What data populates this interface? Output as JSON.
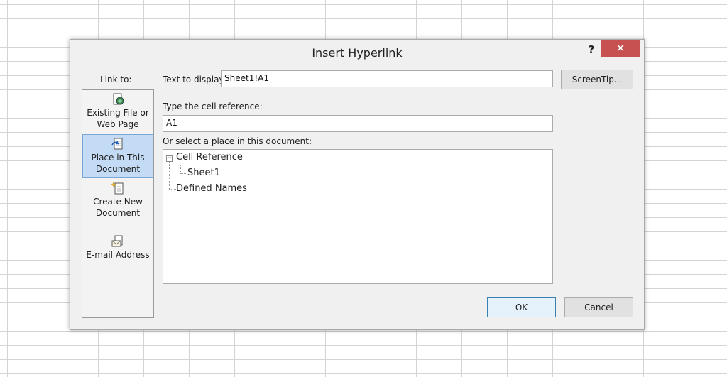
{
  "dialog": {
    "title": "Insert Hyperlink",
    "help": "?",
    "close": "✕"
  },
  "link_to": {
    "label": "Link to:",
    "items": [
      {
        "line1": "Existing File or",
        "line2": "Web Page",
        "icon": "existing-file-icon",
        "selected": false
      },
      {
        "line1": "Place in This",
        "line2": "Document",
        "icon": "place-in-document-icon",
        "selected": true
      },
      {
        "line1": "Create New",
        "line2": "Document",
        "icon": "create-new-document-icon",
        "selected": false
      },
      {
        "line1": "E-mail Address",
        "line2": "",
        "icon": "email-address-icon",
        "selected": false
      }
    ]
  },
  "text_to_display": {
    "label": "Text to display:",
    "value": "Sheet1!A1"
  },
  "screentip": {
    "label": "ScreenTip..."
  },
  "cell_reference": {
    "label": "Type the cell reference:",
    "value": "A1"
  },
  "place": {
    "label": "Or select a place in this document:",
    "tree": {
      "root": "Cell Reference",
      "root_expander": "−",
      "child": "Sheet1",
      "second_root": "Defined Names"
    }
  },
  "buttons": {
    "ok": "OK",
    "cancel": "Cancel"
  },
  "colors": {
    "selected_bg": "#c3dbf5",
    "close_bg": "#c75050",
    "dialog_bg": "#f0f0f0"
  }
}
